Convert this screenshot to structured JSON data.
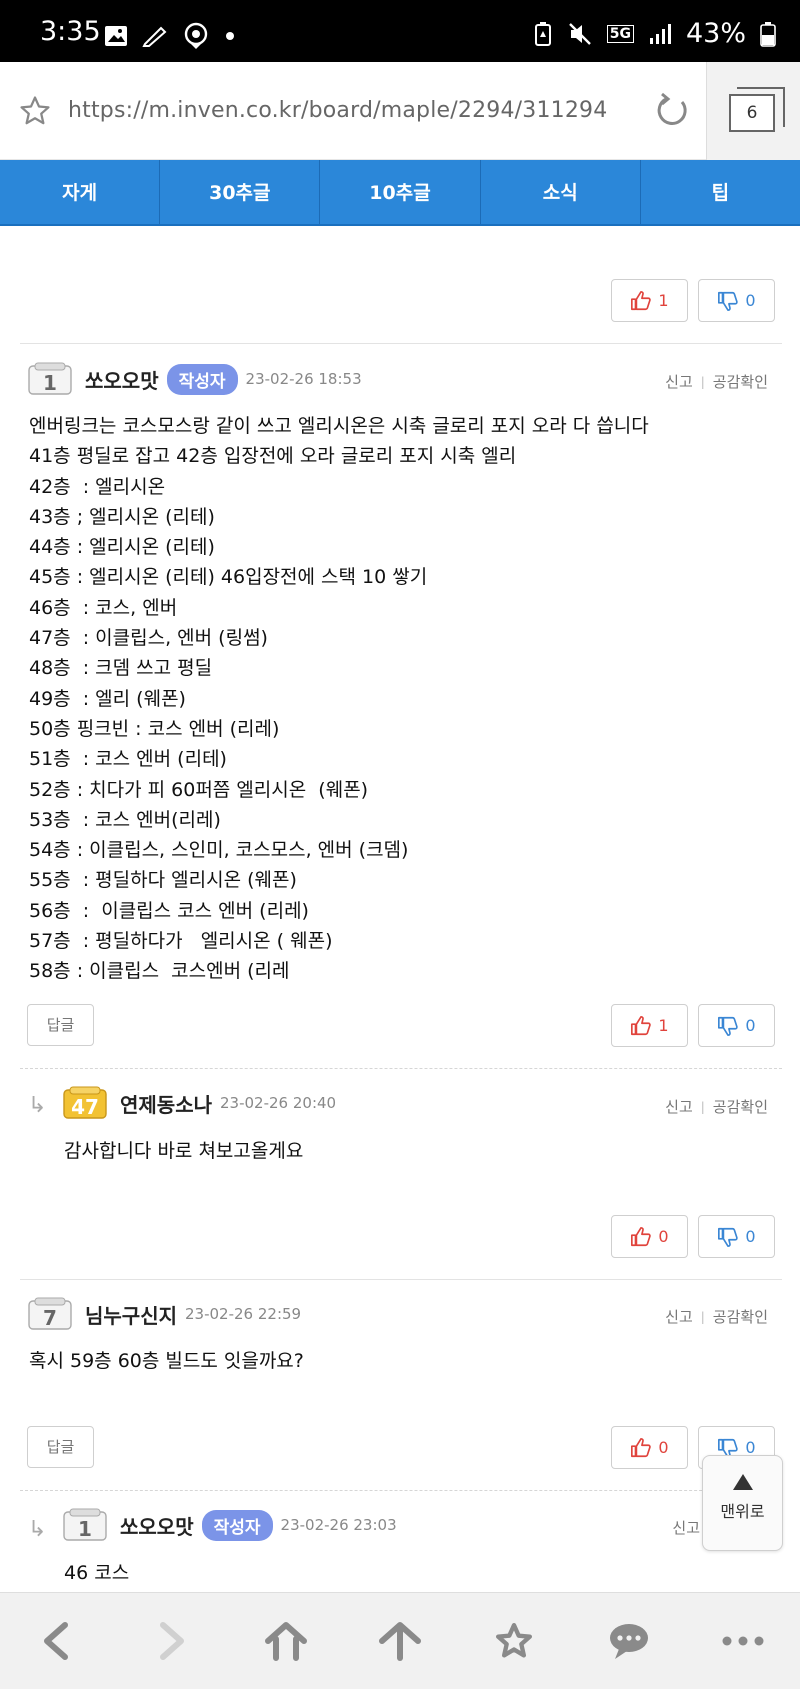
{
  "status_bar": {
    "time": "3:35",
    "network": "5G",
    "battery": "43%"
  },
  "url_bar": {
    "url": "https://m.inven.co.kr/board/maple/2294/311294",
    "tab_count": "6"
  },
  "category_nav": {
    "items": [
      "자게",
      "30추글",
      "10추글",
      "소식",
      "팁"
    ],
    "color": "#2b87d9"
  },
  "top_votes": {
    "up": "1",
    "down": "0"
  },
  "comments": [
    {
      "level": "1",
      "name": "쏘오오맛",
      "author_tag": "작성자",
      "date": "23-02-26 18:53",
      "report": "신고",
      "like_check": "공감확인",
      "body": "엔버링크는 코스모스랑 같이 쓰고 엘리시온은 시축 글로리 포지 오라 다 씁니다\n41층 평딜로 잡고 42층 입장전에 오라 글로리 포지 시축 엘리\n42층  : 엘리시온\n43층 ; 엘리시온 (리테)\n44층 : 엘리시온 (리테)\n45층 : 엘리시온 (리테) 46입장전에 스택 10 쌓기\n46층  : 코스, 엔버\n47층  : 이클립스, 엔버 (링썸)\n48층  : 크뎀 쓰고 평딜\n49층  : 엘리 (웨폰)\n50층 핑크빈 : 코스 엔버 (리레)\n51층  : 코스 엔버 (리테)\n52층 : 치다가 피 60퍼쯤 엘리시온  (웨폰)\n53층  : 코스 엔버(리레)\n54층 : 이클립스, 스인미, 코스모스, 엔버 (크뎀)\n55층  : 평딜하다 엘리시온 (웨폰)\n56층  :  이클립스 코스 엔버 (리레)\n57층  : 평딜하다가   엘리시온 ( 웨폰)\n58층 : 이클립스  코스엔버 (리레",
      "reply_label": "답글",
      "votes": {
        "up": "1",
        "down": "0"
      }
    },
    {
      "level": "47",
      "name": "연제동소나",
      "date": "23-02-26 20:40",
      "report": "신고",
      "like_check": "공감확인",
      "body": "감사합니다 바로 쳐보고올게요",
      "votes": {
        "up": "0",
        "down": "0"
      }
    },
    {
      "level": "7",
      "name": "님누구신지",
      "date": "23-02-26 22:59",
      "report": "신고",
      "like_check": "공감확인",
      "body": "혹시 59층 60층 빌드도 잇을까요?",
      "reply_label": "답글",
      "votes": {
        "up": "0",
        "down": "0"
      }
    },
    {
      "level": "1",
      "name": "쏘오오맛",
      "author_tag": "작성자",
      "date": "23-02-26 23:03",
      "report": "신고",
      "body": "46 코스"
    }
  ],
  "top_button": {
    "label": "맨위로"
  },
  "bottom_nav": {
    "icons": [
      "back-icon",
      "forward-icon",
      "home-icon",
      "scroll-up-icon",
      "bookmark-star-icon",
      "chat-icon",
      "more-icon"
    ]
  }
}
